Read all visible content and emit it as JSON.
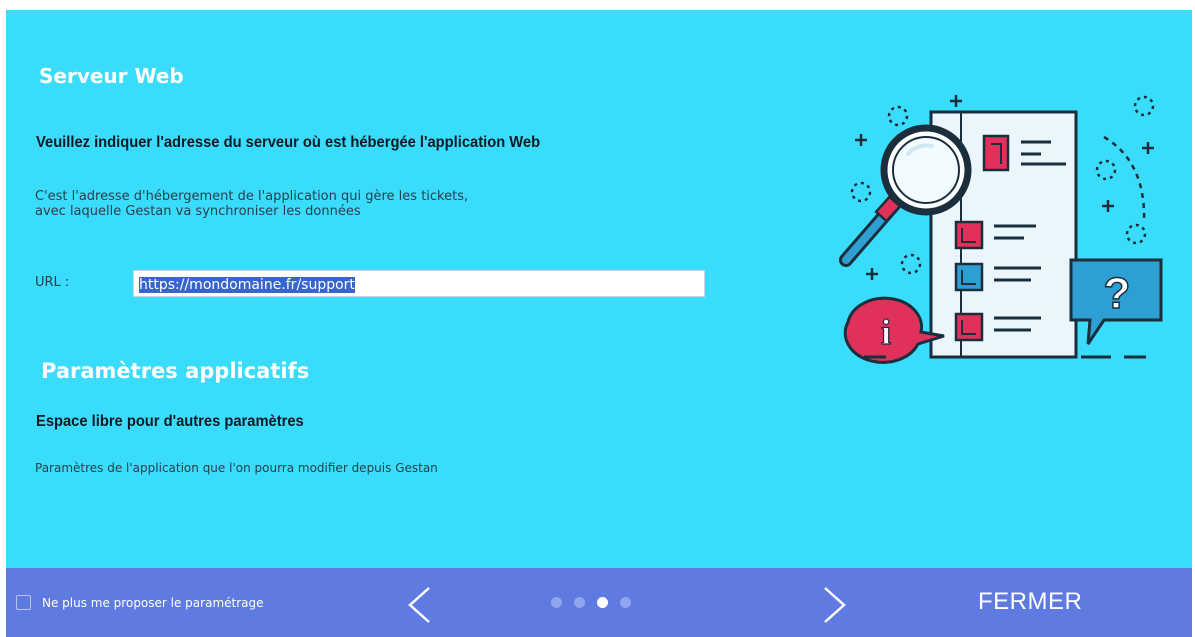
{
  "server": {
    "title": "Serveur Web",
    "subtitle": "Veuillez indiquer l'adresse du serveur où est hébergée l'application Web",
    "description_line1": "C'est l'adresse d'hébergement de l'application qui gère les tickets,",
    "description_line2": "avec laquelle Gestan va synchroniser les données",
    "url_label": "URL :",
    "url_value": "https://mondomaine.fr/support"
  },
  "app_params": {
    "title": "Paramètres applicatifs",
    "subtitle": "Espace libre pour d'autres paramètres",
    "description": "Paramètres de l'application que l'on pourra modifier depuis Gestan"
  },
  "footer": {
    "checkbox_label": "Ne plus me proposer le paramétrage",
    "checkbox_checked": false,
    "close_label": "FERMER",
    "page_count": 4,
    "current_page": 3
  },
  "illustration": {
    "icons": [
      "magnifier-icon",
      "checklist-document-icon",
      "info-bubble-icon",
      "question-bubble-icon"
    ],
    "question_glyph": "?",
    "info_glyph": "i"
  },
  "colors": {
    "background": "#3adcfc",
    "footer": "#5f7ae0",
    "accent_red": "#e0315a",
    "accent_blue": "#2e9fd2",
    "outline": "#1b2e3c"
  }
}
